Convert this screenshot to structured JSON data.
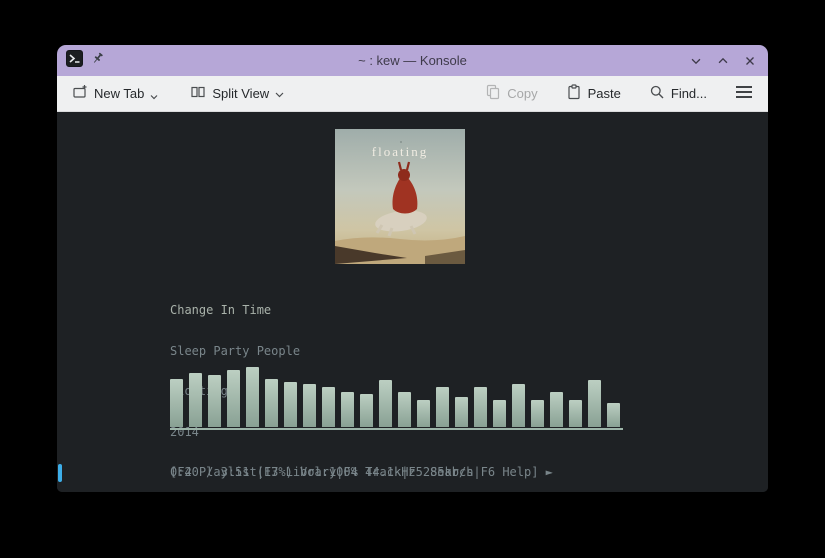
{
  "window": {
    "title": "~ : kew — Konsole"
  },
  "toolbar": {
    "new_tab_label": "New Tab",
    "split_view_label": "Split View",
    "copy_label": "Copy",
    "copy_enabled": false,
    "paste_label": "Paste",
    "find_label": "Find..."
  },
  "terminal": {
    "album_art_text": "floating",
    "track_title": "Change In Time",
    "artist": "Sleep Party People",
    "album": "Floating",
    "year": "2014",
    "status_line": "0:40 / 3:51 (17%) Vol:100% 44.1kHz 285kb/s",
    "help_line": "[F2 Playlist|F3 Library|F4 Track|F5 Search|F6 Help] ►"
  },
  "visualizer": {
    "bar_color_top": "#bccfc2",
    "bar_color_bottom": "#89a194",
    "baseline_color": "#9db5a9",
    "bars": [
      48,
      54,
      52,
      57,
      60,
      48,
      45,
      43,
      40,
      35,
      33,
      47,
      35,
      27,
      40,
      30,
      40,
      27,
      43,
      27,
      35,
      27,
      47,
      24
    ]
  },
  "colors": {
    "titlebar": "#b6a7d7",
    "toolbar_bg": "#eff0f1",
    "terminal_bg": "#1e2124",
    "accent_blue": "#3daee9",
    "text_title": "#a9b2aa",
    "text_dim": "#79858a"
  }
}
